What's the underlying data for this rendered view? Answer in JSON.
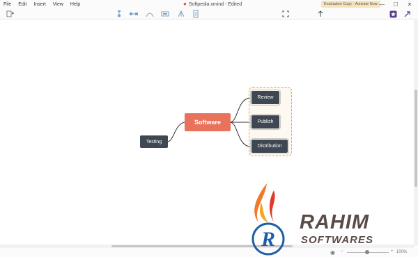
{
  "menu": [
    "File",
    "Edit",
    "Insert",
    "View",
    "Help"
  ],
  "window": {
    "title": "Softpedia.xmind - Edited",
    "evaluation": "Evaluation Copy - Activate Now"
  },
  "mindmap": {
    "central": "Software",
    "left": [
      "Testing"
    ],
    "right": [
      "Review",
      "Publish",
      "Distribution"
    ]
  },
  "status": {
    "zoom": "100%"
  },
  "watermark": {
    "line1": "RAHIM",
    "line2": "SOFTWARES"
  },
  "colors": {
    "central": "#e8725b",
    "node": "#3f4752",
    "group_border": "#e6a24c",
    "title_dot": "#e24b3a"
  }
}
